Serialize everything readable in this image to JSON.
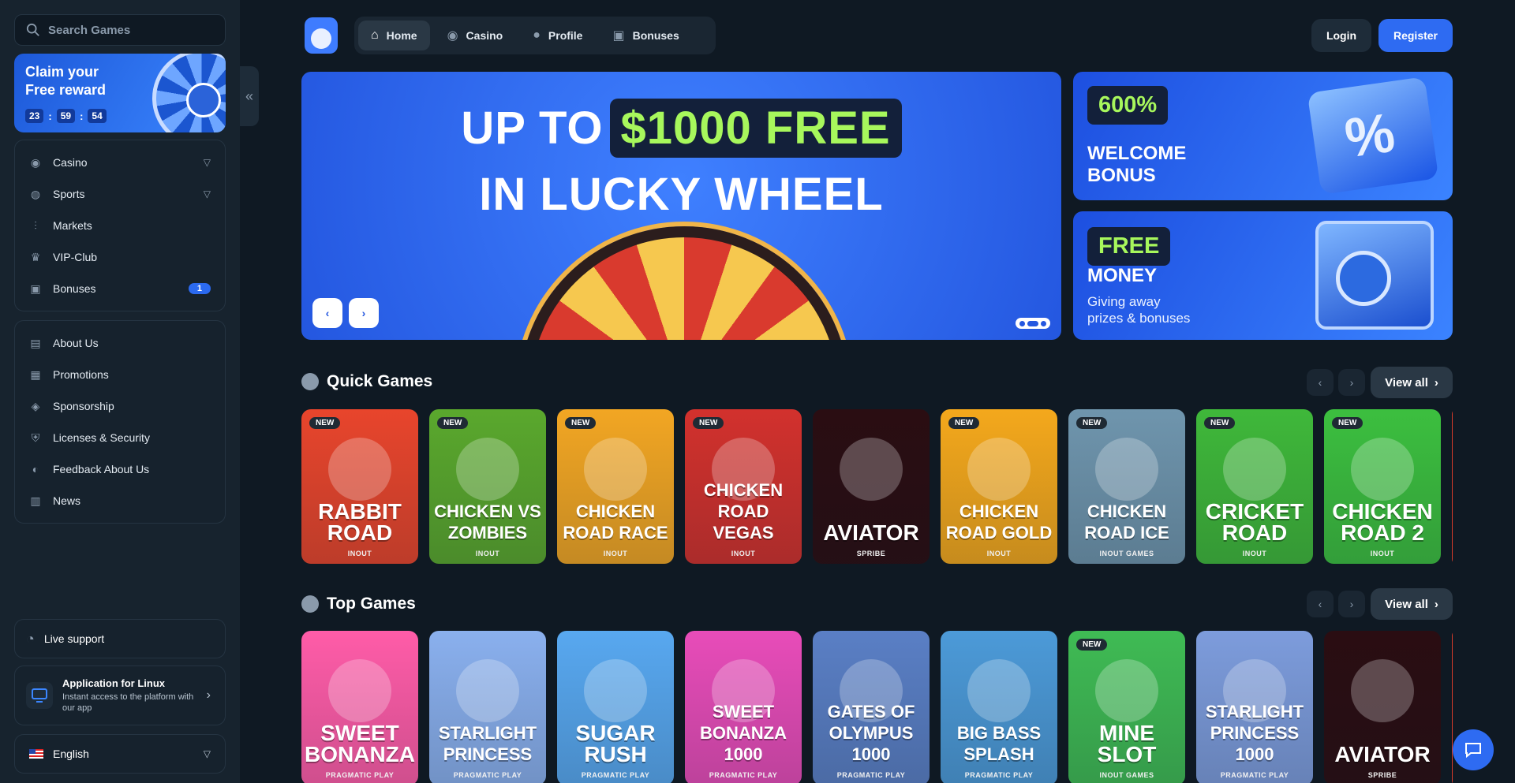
{
  "sidebar": {
    "search_placeholder": "Search Games",
    "claim": {
      "line1": "Claim your",
      "line2": "Free reward",
      "timer": [
        "23",
        "59",
        "54"
      ]
    },
    "nav_primary": [
      {
        "label": "Casino",
        "icon": "casino-icon",
        "expandable": true
      },
      {
        "label": "Sports",
        "icon": "globe-icon",
        "expandable": true
      },
      {
        "label": "Markets",
        "icon": "markets-icon"
      },
      {
        "label": "VIP-Club",
        "icon": "crown-icon"
      },
      {
        "label": "Bonuses",
        "icon": "gift-icon",
        "badge": "1"
      }
    ],
    "nav_secondary": [
      {
        "label": "About Us",
        "icon": "book-icon"
      },
      {
        "label": "Promotions",
        "icon": "tickets-icon"
      },
      {
        "label": "Sponsorship",
        "icon": "medal-icon"
      },
      {
        "label": "Licenses & Security",
        "icon": "shield-icon"
      },
      {
        "label": "Feedback About Us",
        "icon": "feedback-icon"
      },
      {
        "label": "News",
        "icon": "news-icon"
      }
    ],
    "live_support": "Live support",
    "app": {
      "title": "Application for Linux",
      "subtitle": "Instant access to the platform with our app"
    },
    "language": "English"
  },
  "topnav": {
    "tabs": [
      {
        "label": "Home",
        "active": true,
        "icon": "home-icon"
      },
      {
        "label": "Casino",
        "icon": "casino-icon"
      },
      {
        "label": "Profile",
        "icon": "user-icon"
      },
      {
        "label": "Bonuses",
        "icon": "gift-icon"
      }
    ],
    "login": "Login",
    "register": "Register"
  },
  "hero": {
    "line1_prefix": "UP TO",
    "line1_highlight": "$1000 FREE",
    "line2": "IN LUCKY WHEEL",
    "slide_count": 3,
    "active_slide": 2
  },
  "promos": [
    {
      "tag": "600%",
      "title_lines": [
        "WELCOME",
        "BONUS"
      ]
    },
    {
      "tag": "FREE",
      "title": "MONEY",
      "subtitle_lines": [
        "Giving away",
        "prizes & bonuses"
      ]
    }
  ],
  "quick_games": {
    "title": "Quick Games",
    "view_all": "View all",
    "games": [
      {
        "name": "RABBIT ROAD",
        "provider": "INOUT",
        "new": true,
        "color": "#e8452c"
      },
      {
        "name": "CHICKEN VS ZOMBIES",
        "provider": "INOUT",
        "new": true,
        "color": "#5aa82d"
      },
      {
        "name": "CHICKEN ROAD RACE",
        "provider": "INOUT",
        "new": true,
        "color": "#f2a623"
      },
      {
        "name": "CHICKEN ROAD VEGAS",
        "provider": "INOUT",
        "new": true,
        "color": "#d2312d"
      },
      {
        "name": "AVIATOR",
        "provider": "SPRIBE",
        "new": false,
        "color": "#2a0d12"
      },
      {
        "name": "CHICKEN ROAD GOLD",
        "provider": "INOUT",
        "new": true,
        "color": "#f4a81c"
      },
      {
        "name": "CHICKEN ROAD ICE",
        "provider": "INOUT GAMES",
        "new": true,
        "color": "#6f95ad"
      },
      {
        "name": "CRICKET ROAD",
        "provider": "INOUT",
        "new": true,
        "color": "#3fb83a"
      },
      {
        "name": "CHICKEN ROAD 2",
        "provider": "INOUT",
        "new": true,
        "color": "#3cbf3f"
      }
    ]
  },
  "top_games": {
    "title": "Top Games",
    "view_all": "View all",
    "games": [
      {
        "name": "SWEET BONANZA",
        "provider": "PRAGMATIC PLAY",
        "new": false,
        "color": "#ff5ca8"
      },
      {
        "name": "STARLIGHT PRINCESS",
        "provider": "PRAGMATIC PLAY",
        "new": false,
        "color": "#8ab0ee"
      },
      {
        "name": "SUGAR RUSH",
        "provider": "PRAGMATIC PLAY",
        "new": false,
        "color": "#58a8f0"
      },
      {
        "name": "SWEET BONANZA 1000",
        "provider": "PRAGMATIC PLAY",
        "new": false,
        "color": "#e84cb9"
      },
      {
        "name": "GATES OF OLYMPUS 1000",
        "provider": "PRAGMATIC PLAY",
        "new": false,
        "color": "#5a7fc5"
      },
      {
        "name": "BIG BASS SPLASH",
        "provider": "PRAGMATIC PLAY",
        "new": false,
        "color": "#4c9ad8"
      },
      {
        "name": "MINE SLOT",
        "provider": "INOUT GAMES",
        "new": true,
        "color": "#3fbb54"
      },
      {
        "name": "STARLIGHT PRINCESS 1000",
        "provider": "PRAGMATIC PLAY",
        "new": false,
        "color": "#7d9cdc"
      },
      {
        "name": "AVIATOR",
        "provider": "SPRIBE",
        "new": false,
        "color": "#2a0d12"
      }
    ]
  }
}
